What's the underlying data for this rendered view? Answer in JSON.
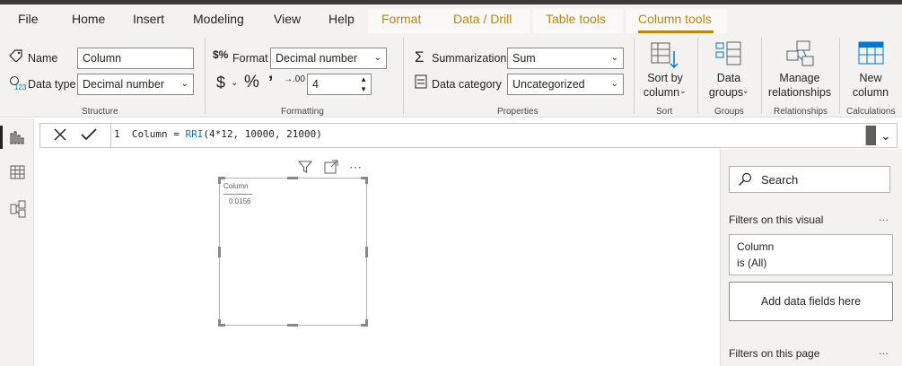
{
  "tabs": [
    "File",
    "Home",
    "Insert",
    "Modeling",
    "View",
    "Help"
  ],
  "context_tabs": [
    "Format",
    "Data / Drill",
    "Table tools",
    "Column tools"
  ],
  "structure": {
    "name_label": "Name",
    "name_value": "Column",
    "datatype_label": "Data type",
    "datatype_value": "Decimal number",
    "group_label": "Structure"
  },
  "formatting": {
    "format_label": "Format",
    "format_value": "Decimal number",
    "decimals_value": "4",
    "group_label": "Formatting"
  },
  "properties": {
    "summarization_label": "Summarization",
    "summarization_value": "Sum",
    "category_label": "Data category",
    "category_value": "Uncategorized",
    "group_label": "Properties"
  },
  "sort": {
    "line1": "Sort by",
    "line2": "column",
    "group_label": "Sort"
  },
  "groups": {
    "line1": "Data",
    "line2": "groups",
    "group_label": "Groups"
  },
  "relationships": {
    "line1": "Manage",
    "line2": "relationships",
    "group_label": "Relationships"
  },
  "calculations": {
    "line1": "New",
    "line2": "column",
    "group_label": "Calculations"
  },
  "formula": {
    "line_no": "1",
    "text_before": "Column = ",
    "func": "RRI",
    "text_after": "(4*12, 10000, 21000)"
  },
  "visual": {
    "header": "Column",
    "value": "0.0156"
  },
  "filters": {
    "search_placeholder": "Search",
    "on_visual_title": "Filters on this visual",
    "card_field": "Column",
    "card_value": "is (All)",
    "add_fields": "Add data fields here",
    "on_page_title": "Filters on this page",
    "more": "..."
  }
}
